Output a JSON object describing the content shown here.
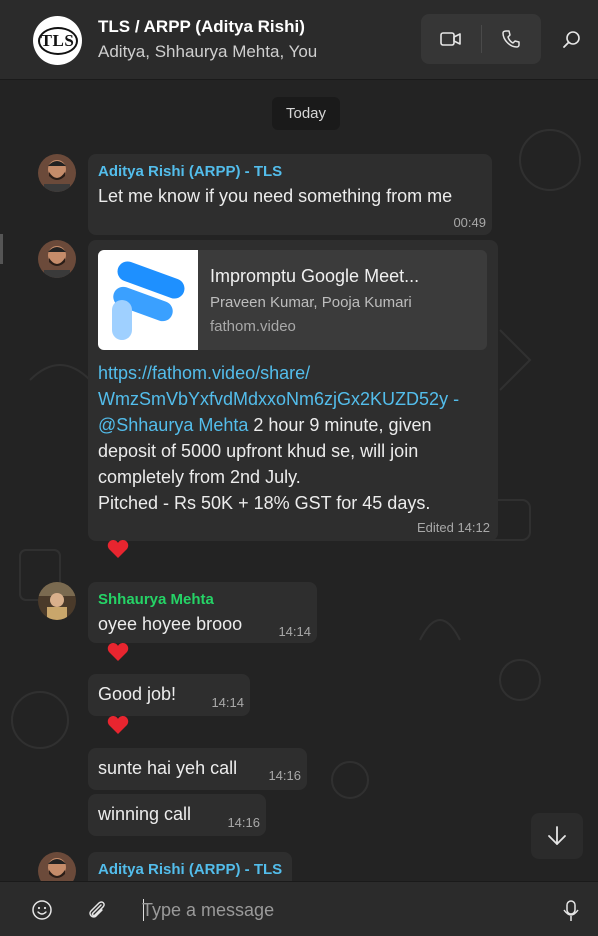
{
  "header": {
    "avatar_text": "TLS",
    "title": "TLS / ARPP (Aditya Rishi)",
    "members": "Aditya, Shhaurya Mehta, You",
    "video_call": "video-camera-icon",
    "voice_call": "phone-icon",
    "search": "search-icon"
  },
  "chat": {
    "date_label": "Today",
    "colors": {
      "aditya": "#53bdeb",
      "shhaurya": "#25d366",
      "bubble": "#2e2e2e",
      "link": "#53bdeb"
    },
    "messages": [
      {
        "sender": "Aditya Rishi (ARPP) - TLS",
        "text": "Let me know if you need something from me",
        "time": "00:49"
      },
      {
        "link_preview": {
          "title": "Impromptu Google Meet...",
          "subtitle": "Praveen Kumar, Pooja Kumari",
          "domain": "fathom.video"
        },
        "url_line1": "https://fathom.video/share/",
        "url_line2": "WmzSmVbYxfvdMdxxoNm6zjGx2KUZD52y",
        "dash": " -",
        "mention": "@Shhaurya Mehta",
        "text_after_mention": " 2 hour 9 minute, given",
        "line4": "deposit of 5000 upfront khud se, will join",
        "line5": "completely from 2nd July.",
        "line6": "Pitched - Rs 50K + 18% GST for 45 days.",
        "time": "Edited 14:12",
        "reaction": "red-heart"
      },
      {
        "sender": "Shhaurya Mehta",
        "text": "oyee hoyee brooo",
        "time": "14:14",
        "reaction": "red-heart"
      },
      {
        "text": "Good job!",
        "time": "14:14",
        "reaction": "red-heart"
      },
      {
        "text": "sunte hai yeh call",
        "time": "14:16"
      },
      {
        "text": "winning call",
        "time": "14:16"
      },
      {
        "sender": "Aditya Rishi (ARPP) - TLS"
      }
    ]
  },
  "composer": {
    "placeholder": "Type a message",
    "emoji": "emoji-icon",
    "attach": "paperclip-icon",
    "mic": "microphone-icon"
  },
  "scroll_down": "arrow-down-icon"
}
